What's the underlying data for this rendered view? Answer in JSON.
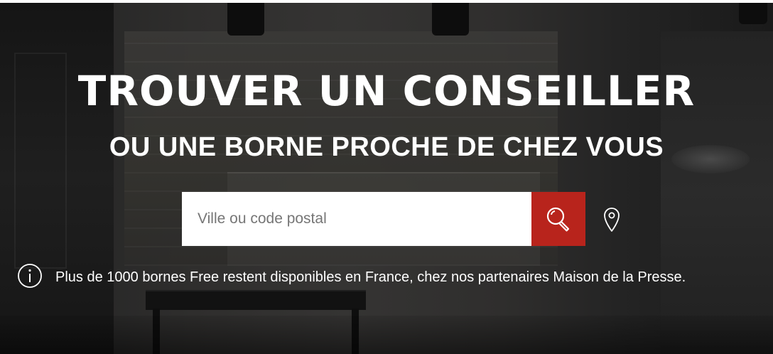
{
  "hero": {
    "title": "TROUVER UN CONSEILLER",
    "subtitle": "OU UNE BORNE PROCHE DE CHEZ VOUS"
  },
  "search": {
    "placeholder": "Ville ou code postal",
    "value": ""
  },
  "icons": {
    "search_button_icon": "search-icon",
    "location_button_icon": "map-pin-icon",
    "info_icon": "info-icon"
  },
  "info": {
    "text": "Plus de 1000 bornes Free restent disponibles en France, chez nos partenaires Maison de la Presse."
  },
  "colors": {
    "accent": "#b8241c",
    "text": "#ffffff",
    "input_background": "#ffffff"
  }
}
